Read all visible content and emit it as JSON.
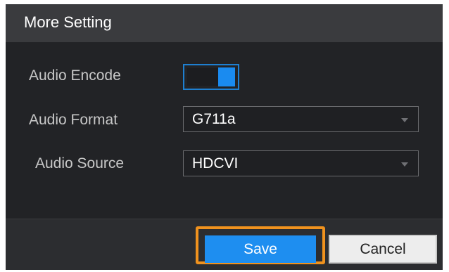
{
  "dialog": {
    "title": "More Setting",
    "audio_encode": {
      "label": "Audio Encode",
      "enabled": true
    },
    "audio_format": {
      "label": "Audio Format",
      "value": "G711a"
    },
    "audio_source": {
      "label": "Audio Source",
      "value": "HDCVI"
    }
  },
  "footer": {
    "save_label": "Save",
    "cancel_label": "Cancel"
  },
  "colors": {
    "accent": "#1e8ef0",
    "highlight": "#f0921e",
    "dialog_bg": "#222326"
  },
  "icons": {
    "dropdown": "chevron-down-icon"
  }
}
